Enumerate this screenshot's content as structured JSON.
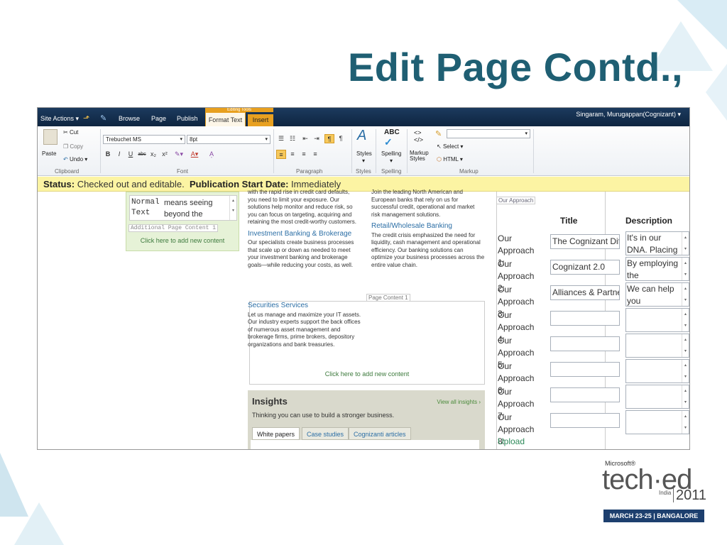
{
  "slide": {
    "title": "Edit Page Contd.,",
    "logo": {
      "microsoft": "Microsoft®",
      "brand": "tech·ed",
      "region": "India",
      "year": "2011",
      "dates": "MARCH 23-25  |  BANGALORE"
    }
  },
  "topbar": {
    "site_actions": "Site Actions ▾",
    "browse": "Browse",
    "page": "Page",
    "publish": "Publish",
    "editing_tools": "Editing Tools",
    "format_text": "Format Text",
    "insert": "Insert",
    "user": "Singaram, Murugappan(Cognizant) ▾"
  },
  "ribbon": {
    "clipboard": {
      "paste": "Paste",
      "cut": "Cut",
      "copy": "Copy",
      "undo": "Undo",
      "label": "Clipboard"
    },
    "font": {
      "family": "Trebuchet MS",
      "size": "8pt",
      "label": "Font"
    },
    "paragraph": {
      "label": "Paragraph"
    },
    "styles": {
      "button": "Styles",
      "label": "Styles"
    },
    "spelling": {
      "button": "Spelling",
      "label": "Spelling"
    },
    "markup": {
      "markup_styles": "Markup Styles",
      "select": "Select",
      "html": "HTML",
      "label": "Markup"
    }
  },
  "status": {
    "status_label": "Status:",
    "status_value": "Checked out and editable.",
    "pub_label": "Publication Start Date:",
    "pub_value": "Immediately"
  },
  "left_panel": {
    "style_name_1": "Normal",
    "style_name_2": "Text",
    "text_1": "means seeing",
    "text_2": "beyond the",
    "label": "Additional Page Content 1",
    "add_link": "Click here to add new content"
  },
  "page_content": {
    "col1_top": "with the rapid rise in credit card defaults, you need to limit your exposure. Our solutions help monitor and reduce risk, so you can focus on targeting, acquiring and retaining the most credit-worthy customers.",
    "ib_heading": "Investment Banking & Brokerage",
    "ib_text": "Our specialists create business processes that scale up or down as needed to meet your investment banking and brokerage goals—while reducing your costs, as well.",
    "col2_top": "Join the leading North American and European banks that rely on us for successful credit, operational and market risk management solutions.",
    "retail_heading": "Retail/Wholesale Banking",
    "retail_text": "The credit crisis emphasized the need for liquidity, cash management and operational efficiency. Our banking solutions can optimize your business processes across the entire value chain.",
    "pc_label": "Page Content 1",
    "sec_heading": "Securities Services",
    "sec_text": "Let us manage and maximize your IT assets. Our industry experts support the back offices of numerous asset management and brokerage firms, prime brokers, depository organizations and bank treasuries.",
    "add_link": "Click here to add new content"
  },
  "insights": {
    "title": "Insights",
    "subtitle": "Thinking you can use to build a stronger business.",
    "view_all": "View all insights ›",
    "tabs": [
      "White papers",
      "Case studies",
      "Cognizanti articles"
    ]
  },
  "approach": {
    "label": "Our Approach",
    "col_title": "Title",
    "col_desc": "Description",
    "rows": [
      {
        "name": "Our Approach",
        "num": "1:",
        "title": "The Cognizant Dif",
        "desc1": "It's in our",
        "desc2": "DNA. Placing"
      },
      {
        "name": "Our Approach",
        "num": "2:",
        "title": "Cognizant 2.0",
        "desc1": "By employing",
        "desc2": "the"
      },
      {
        "name": "Our Approach",
        "num": "3:",
        "title": "Alliances & Partne",
        "desc1": "We can help",
        "desc2": "you"
      },
      {
        "name": "Our Approach",
        "num": "4:",
        "title": "",
        "desc1": "",
        "desc2": ""
      },
      {
        "name": "Our Approach",
        "num": "5:",
        "title": "",
        "desc1": "",
        "desc2": ""
      },
      {
        "name": "Our Approach",
        "num": "6:",
        "title": "",
        "desc1": "",
        "desc2": ""
      },
      {
        "name": "Our Approach",
        "num": "7:",
        "title": "",
        "desc1": "",
        "desc2": ""
      },
      {
        "name": "Our Approach",
        "num": "8:",
        "title": "",
        "desc1": "",
        "desc2": ""
      }
    ],
    "upload": "Upload"
  }
}
